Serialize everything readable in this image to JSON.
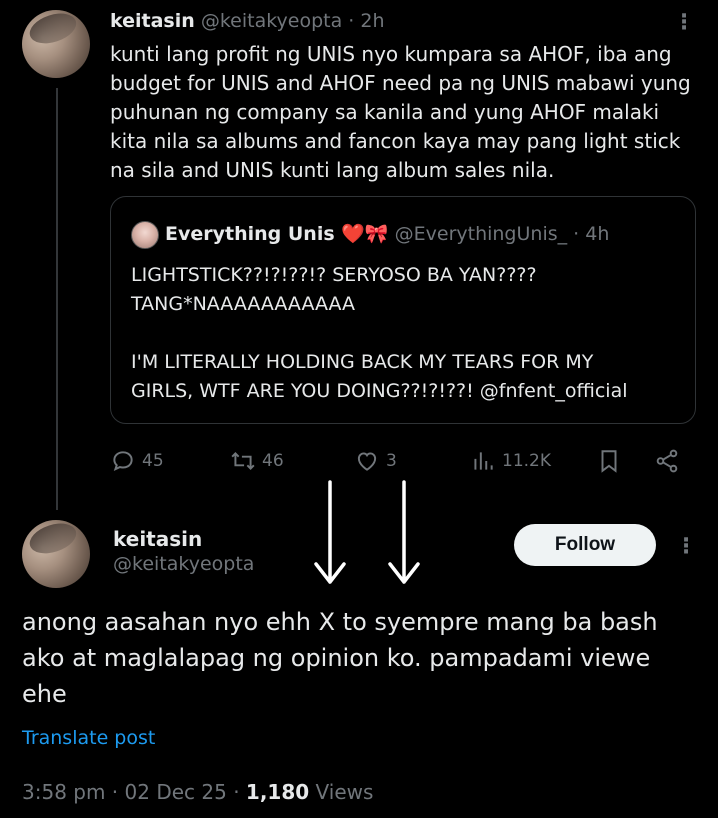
{
  "tweet1": {
    "display_name": "keitasin",
    "handle": "@keitakyeopta",
    "separator": " · ",
    "time": "2h",
    "text": "kunti lang profit ng UNIS nyo kumpara sa AHOF, iba ang budget for UNIS and AHOF need pa ng UNIS mabawi yung puhunan ng company sa kanila and yung AHOF malaki kita nila sa albums and fancon kaya may pang light stick na sila and UNIS kunti lang album sales nila."
  },
  "quote": {
    "display_name": "Everything Unis ❤️🎀",
    "handle": "@EverythingUnis_",
    "separator": " · ",
    "time": "4h",
    "line1": "LIGHTSTICK??!?!??!? SERYOSO BA YAN????",
    "line2": "TANG*NAAAAAAAAAAA",
    "line3": "I'M LITERALLY HOLDING BACK MY TEARS FOR MY",
    "line4": "GIRLS, WTF ARE YOU DOING??!?!??! @fnfent_official"
  },
  "actions": {
    "replies": "45",
    "reposts": "46",
    "likes": "3",
    "views": "11.2K"
  },
  "tweet2": {
    "display_name": "keitasin",
    "handle": "@keitakyeopta",
    "follow_label": "Follow",
    "text": "anong aasahan nyo ehh X to syempre mang ba bash ako at maglalapag ng opinion ko. pampadami viewe ehe",
    "translate_label": "Translate post",
    "timestamp": "3:58 pm · 02 Dec 25 · ",
    "view_count": "1,180",
    "views_label": " Views"
  },
  "colors": {
    "background": "#000000",
    "text": "#e7e9ea",
    "muted": "#71767b",
    "link": "#1d9bf0",
    "follow_bg": "#eff3f4"
  }
}
